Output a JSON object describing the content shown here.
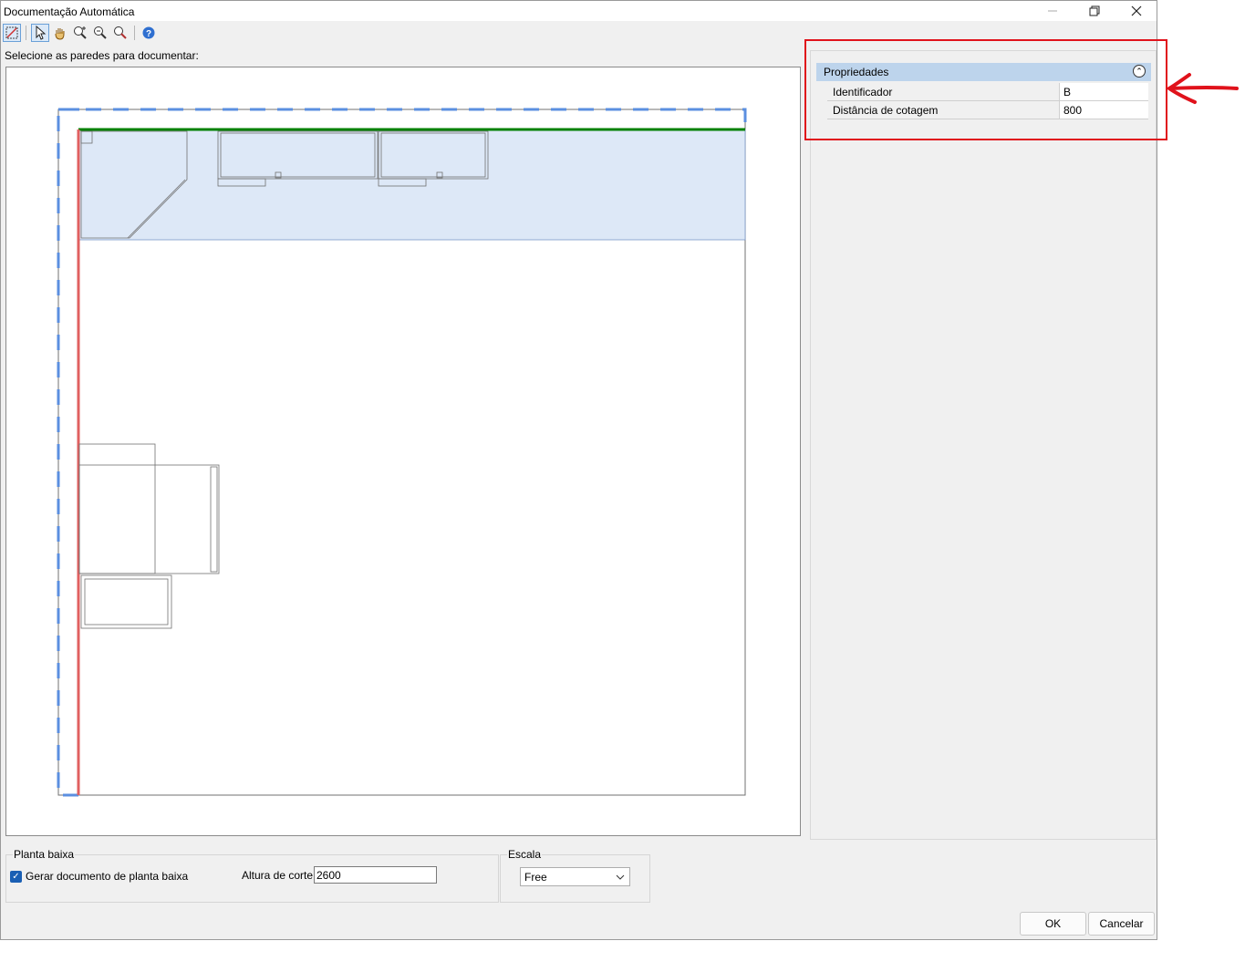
{
  "window": {
    "title": "Documentação Automática"
  },
  "toolbar": {
    "tools": [
      "wall-select-icon",
      "pointer-icon",
      "pan-hand-icon",
      "zoom-window-icon",
      "zoom-out-icon",
      "zoom-extents-icon",
      "help-icon"
    ]
  },
  "prompt": "Selecione as paredes para documentar:",
  "properties": {
    "header": "Propriedades",
    "rows": [
      {
        "key": "Identificador",
        "value": "B"
      },
      {
        "key": "Distância de cotagem",
        "value": "800"
      }
    ]
  },
  "floorplan_group": {
    "legend": "Planta baixa",
    "checkbox_label": "Gerar documento de planta baixa",
    "checked": true,
    "cut_height_label": "Altura de corte:",
    "cut_height_value": "2600"
  },
  "scale_group": {
    "legend": "Escala",
    "selected": "Free"
  },
  "buttons": {
    "ok": "OK",
    "cancel": "Cancelar"
  },
  "colors": {
    "annotation": "#e0121b",
    "selected_wall": "#008000",
    "highlight_wall": "#e06060",
    "selection_dash": "#5b8fe0",
    "highlight_fill": "#dde8f7"
  }
}
